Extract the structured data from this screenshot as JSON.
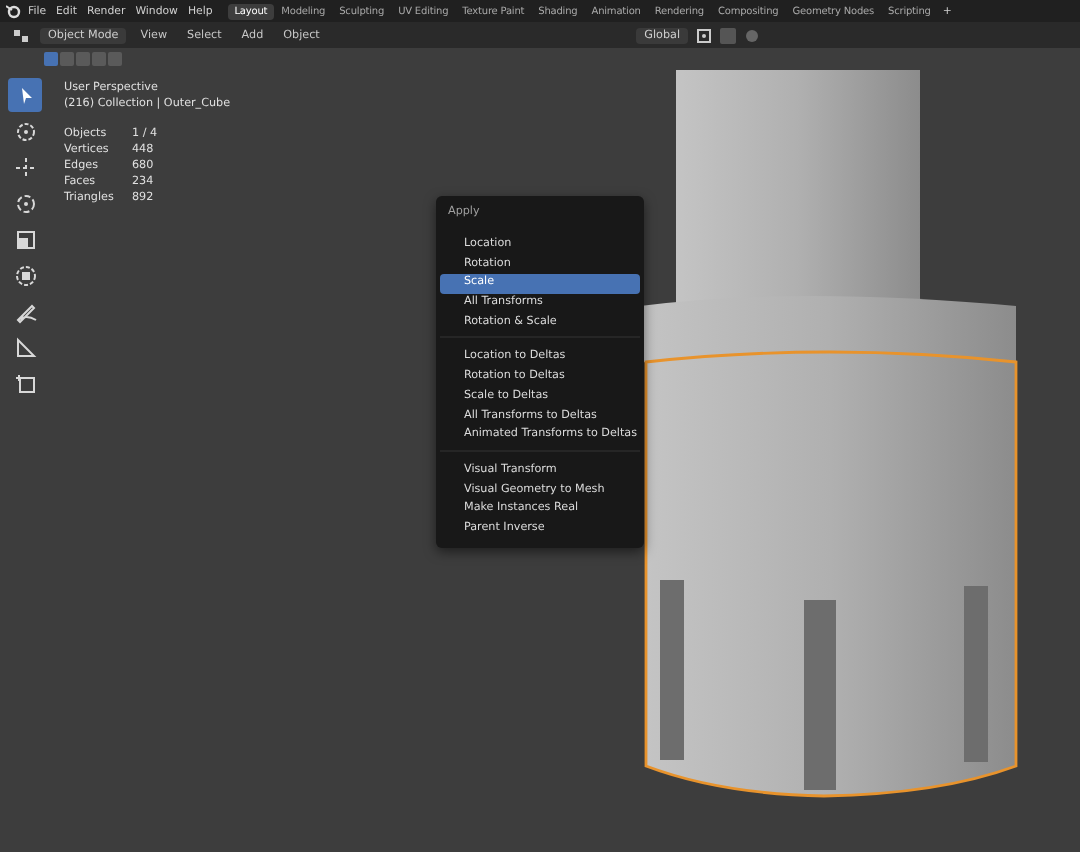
{
  "menu_bar": {
    "items": [
      "File",
      "Edit",
      "Render",
      "Window",
      "Help"
    ]
  },
  "workspaces": [
    {
      "label": "Layout",
      "selected": true
    },
    {
      "label": "Modeling",
      "selected": false
    },
    {
      "label": "Sculpting",
      "selected": false
    },
    {
      "label": "UV Editing",
      "selected": false
    },
    {
      "label": "Texture Paint",
      "selected": false
    },
    {
      "label": "Shading",
      "selected": false
    },
    {
      "label": "Animation",
      "selected": false
    },
    {
      "label": "Rendering",
      "selected": false
    },
    {
      "label": "Compositing",
      "selected": false
    },
    {
      "label": "Geometry Nodes",
      "selected": false
    },
    {
      "label": "Scripting",
      "selected": false
    }
  ],
  "add_workspace": "+",
  "header": {
    "mode": "Object Mode",
    "menus": [
      "View",
      "Select",
      "Add",
      "Object"
    ],
    "orientation": "Global"
  },
  "select_modes": [
    {
      "selected": true
    },
    {
      "selected": false
    },
    {
      "selected": false
    },
    {
      "selected": false
    },
    {
      "selected": false
    }
  ],
  "tools": [
    {
      "kind": "select",
      "selected": true
    },
    {
      "kind": "cursor",
      "selected": false
    },
    {
      "kind": "move",
      "selected": false
    },
    {
      "kind": "rotate",
      "selected": false
    },
    {
      "kind": "scale",
      "selected": false
    },
    {
      "kind": "transform",
      "selected": false
    },
    {
      "kind": "annotate",
      "selected": false
    },
    {
      "kind": "measure",
      "selected": false
    },
    {
      "kind": "add_cube",
      "selected": false
    }
  ],
  "overlay": {
    "view": "User Perspective",
    "collection": "(216) Collection | Outer_Cube",
    "stats": [
      {
        "label": "Objects",
        "value": "1 / 4"
      },
      {
        "label": "Vertices",
        "value": "448"
      },
      {
        "label": "Edges",
        "value": "680"
      },
      {
        "label": "Faces",
        "value": "234"
      },
      {
        "label": "Triangles",
        "value": "892"
      }
    ]
  },
  "apply_menu": {
    "title": "Apply",
    "groups": [
      [
        {
          "label": "Location",
          "selected": false
        },
        {
          "label": "Rotation",
          "selected": false
        },
        {
          "label": "Scale",
          "selected": true
        },
        {
          "label": "All Transforms",
          "selected": false
        },
        {
          "label": "Rotation & Scale",
          "selected": false
        }
      ],
      [
        {
          "label": "Location to Deltas",
          "selected": false
        },
        {
          "label": "Rotation to Deltas",
          "selected": false
        },
        {
          "label": "Scale to Deltas",
          "selected": false
        },
        {
          "label": "All Transforms to Deltas",
          "selected": false
        },
        {
          "label": "Animated Transforms to Deltas",
          "selected": false
        }
      ],
      [
        {
          "label": "Visual Transform",
          "selected": false
        },
        {
          "label": "Visual Geometry to Mesh",
          "selected": false
        },
        {
          "label": "Make Instances Real",
          "selected": false
        },
        {
          "label": "Parent Inverse",
          "selected": false
        }
      ]
    ]
  }
}
